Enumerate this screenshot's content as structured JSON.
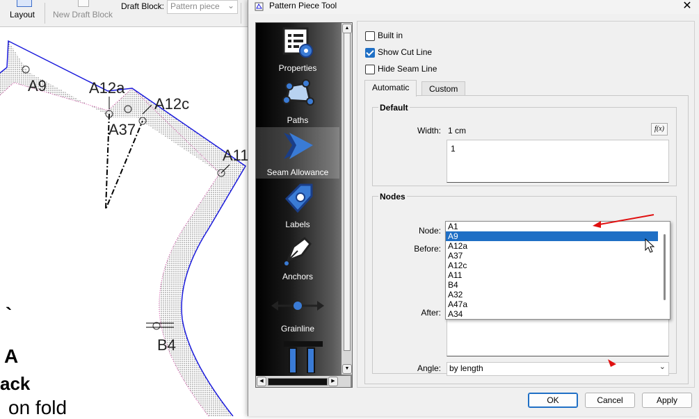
{
  "toolbar": {
    "layout_label": "Layout",
    "new_draft_label": "New Draft Block",
    "draft_block_label": "Draft Block:",
    "draft_block_value": "Pattern piece"
  },
  "canvas": {
    "point_labels": {
      "a9": "A9",
      "a12a": "A12a",
      "a12c": "A12c",
      "a37": "A37",
      "a11": "A11",
      "b4": "B4"
    },
    "backtick": "`",
    "text_a": "A",
    "text_back": "ack",
    "text_fold": "on fold"
  },
  "dialog": {
    "title": "Pattern Piece Tool",
    "close": "✕",
    "nav": [
      {
        "label": "Properties",
        "icon": "properties-icon"
      },
      {
        "label": "Paths",
        "icon": "paths-icon"
      },
      {
        "label": "Seam Allowance",
        "icon": "seam-allowance-icon"
      },
      {
        "label": "Labels",
        "icon": "labels-icon"
      },
      {
        "label": "Anchors",
        "icon": "anchors-icon"
      },
      {
        "label": "Grainline",
        "icon": "grainline-icon"
      }
    ],
    "checkboxes": {
      "built_in": "Built in",
      "show_cut_line": "Show Cut Line",
      "hide_seam_line": "Hide Seam Line"
    },
    "tabs": {
      "automatic": "Automatic",
      "custom": "Custom"
    },
    "default_group": {
      "title": "Default",
      "width_label": "Width:",
      "width_value": "1 cm",
      "fx_label": "f(x)",
      "formula": "1"
    },
    "nodes_group": {
      "title": "Nodes",
      "node_label": "Node:",
      "node_value": "A9",
      "before_label": "Before:",
      "after_label": "After:",
      "angle_label": "Angle:",
      "angle_value": "by length"
    },
    "node_options": [
      "A1",
      "A9",
      "A12a",
      "A37",
      "A12c",
      "A11",
      "B4",
      "A32",
      "A47a",
      "A34"
    ],
    "buttons": {
      "ok": "OK",
      "cancel": "Cancel",
      "apply": "Apply"
    }
  },
  "colors": {
    "accent": "#1f6fc5",
    "seam_line": "#1a1adc",
    "annotation_arrow": "#e01010"
  }
}
